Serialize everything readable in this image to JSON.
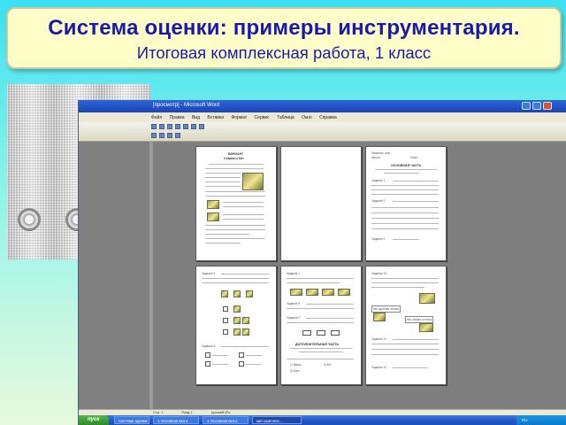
{
  "banner": {
    "title": "Система оценки: примеры инструментария.",
    "subtitle": "Итоговая комплексная работа, 1 класс"
  },
  "word_window": {
    "title": "[просмотр] - Microsoft Word",
    "menu": [
      "Файл",
      "Правка",
      "Вид",
      "Вставка",
      "Формат",
      "Сервис",
      "Таблица",
      "Окно",
      "Справка"
    ],
    "pages": {
      "page1": {
        "heading_1": "ВАРИАНТ",
        "heading_2": "Старик и Кот"
      },
      "page3": {
        "line_1": "Фамилия, имя",
        "line_2": "Школа",
        "line_3": "Класс",
        "heading": "ОСНОВНАЯ ЧАСТЬ",
        "task_1": "Задание 1",
        "task_2": "Задание 2",
        "task_3": "Задание 3"
      },
      "page4": {
        "task_5": "Задание 5",
        "task_6": "Задание 6"
      },
      "page5": {
        "task_7": "Задание 7",
        "task_8": "Задание 8",
        "task_9": "Задание 9",
        "additional": "ДОПОЛНИТЕЛЬНАЯ ЧАСТЬ",
        "choice_a": "1) Маша",
        "choice_b": "2) Кот",
        "choice_c": "3) Конь"
      },
      "page6": {
        "task_10": "Задание 10",
        "task_11": "Задание 11",
        "task_12": "Задание 12",
        "label_1": "Мы сдобная птичка",
        "label_2": "Мы собаки и птица"
      }
    },
    "status": {
      "page": "Стр. 1",
      "section": "Разд 1",
      "lang": "русский (Ро"
    }
  },
  "taskbar": {
    "start": "пуск",
    "tasks": [
      "Система оценки",
      "1 Основная вкл.к",
      "1 Основная вкл.к",
      "кий комплекс..."
    ],
    "tray_time": "RU"
  },
  "colors": {
    "banner_text": "#1a1aa8",
    "banner_bg": "#fefec8",
    "background_top": "#3be0f2",
    "background_bottom": "#e6f9dd",
    "titlebar": "#2f64d9"
  }
}
